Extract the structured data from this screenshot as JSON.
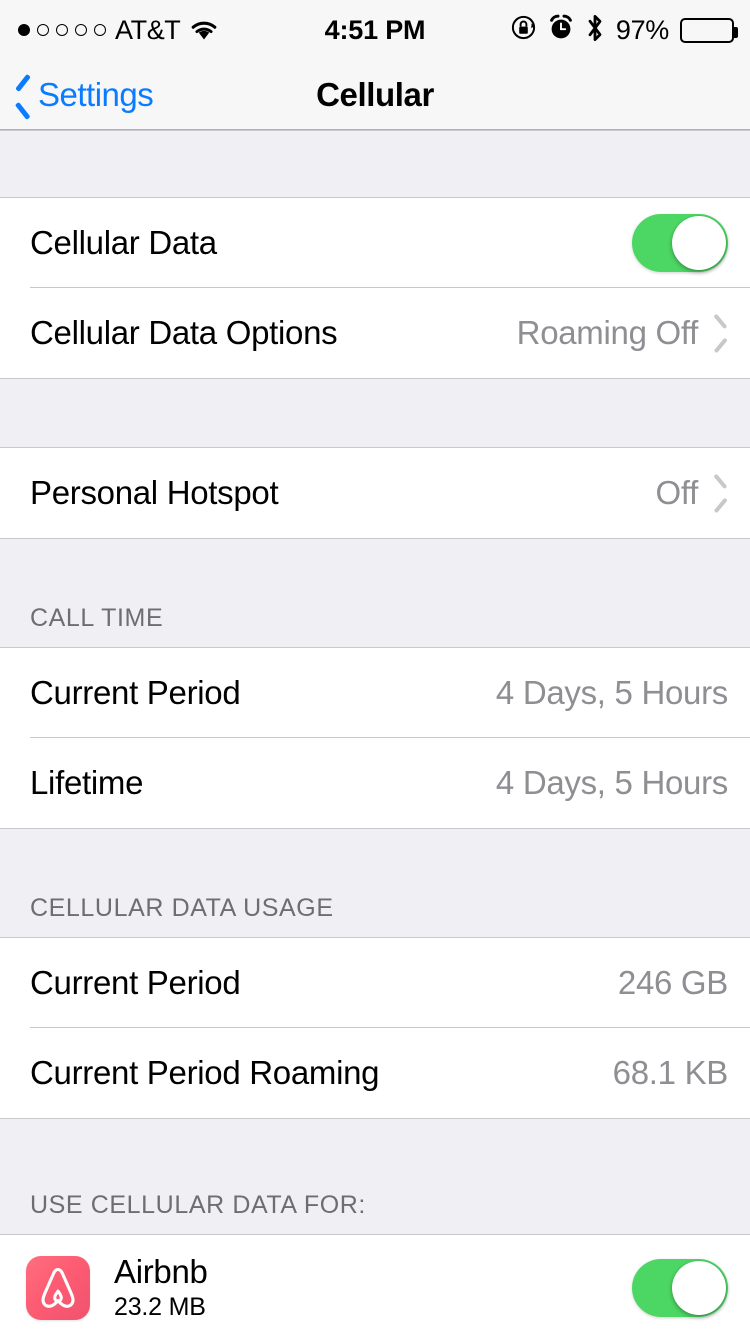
{
  "status_bar": {
    "signal_dots_total": 5,
    "signal_dots_filled": 1,
    "carrier": "AT&T",
    "wifi_icon": "wifi-icon",
    "time": "4:51 PM",
    "rotation_lock_icon": "rotation-lock-icon",
    "alarm_icon": "alarm-clock-icon",
    "bluetooth_icon": "bluetooth-icon",
    "battery_percent": "97%",
    "battery_level": 97
  },
  "nav_bar": {
    "back_label": "Settings",
    "back_icon": "chevron-left-icon",
    "title": "Cellular"
  },
  "groups": [
    {
      "rows": [
        {
          "label": "Cellular Data",
          "control": "toggle",
          "value": "on"
        },
        {
          "label": "Cellular Data Options",
          "detail": "Roaming Off",
          "control": "chevron"
        }
      ]
    },
    {
      "rows": [
        {
          "label": "Personal Hotspot",
          "detail": "Off",
          "control": "chevron"
        }
      ]
    },
    {
      "header": "CALL TIME",
      "rows": [
        {
          "label": "Current Period",
          "detail": "4 Days, 5 Hours"
        },
        {
          "label": "Lifetime",
          "detail": "4 Days, 5 Hours"
        }
      ]
    },
    {
      "header": "CELLULAR DATA USAGE",
      "rows": [
        {
          "label": "Current Period",
          "detail": "246 GB"
        },
        {
          "label": "Current Period Roaming",
          "detail": "68.1 KB"
        }
      ]
    },
    {
      "header": "USE CELLULAR DATA FOR:",
      "apps": [
        {
          "name": "Airbnb",
          "size": "23.2 MB",
          "icon": "airbnb-app-icon",
          "toggle": "on"
        }
      ]
    }
  ],
  "colors": {
    "tint_blue": "#0A7CFF",
    "toggle_green": "#4CD764",
    "group_background": "#EFEFF4",
    "detail_gray": "#8E8E93",
    "header_gray": "#6D6D72",
    "separator": "#C8C7CC",
    "app_icon_pink": "#FD5C72"
  }
}
